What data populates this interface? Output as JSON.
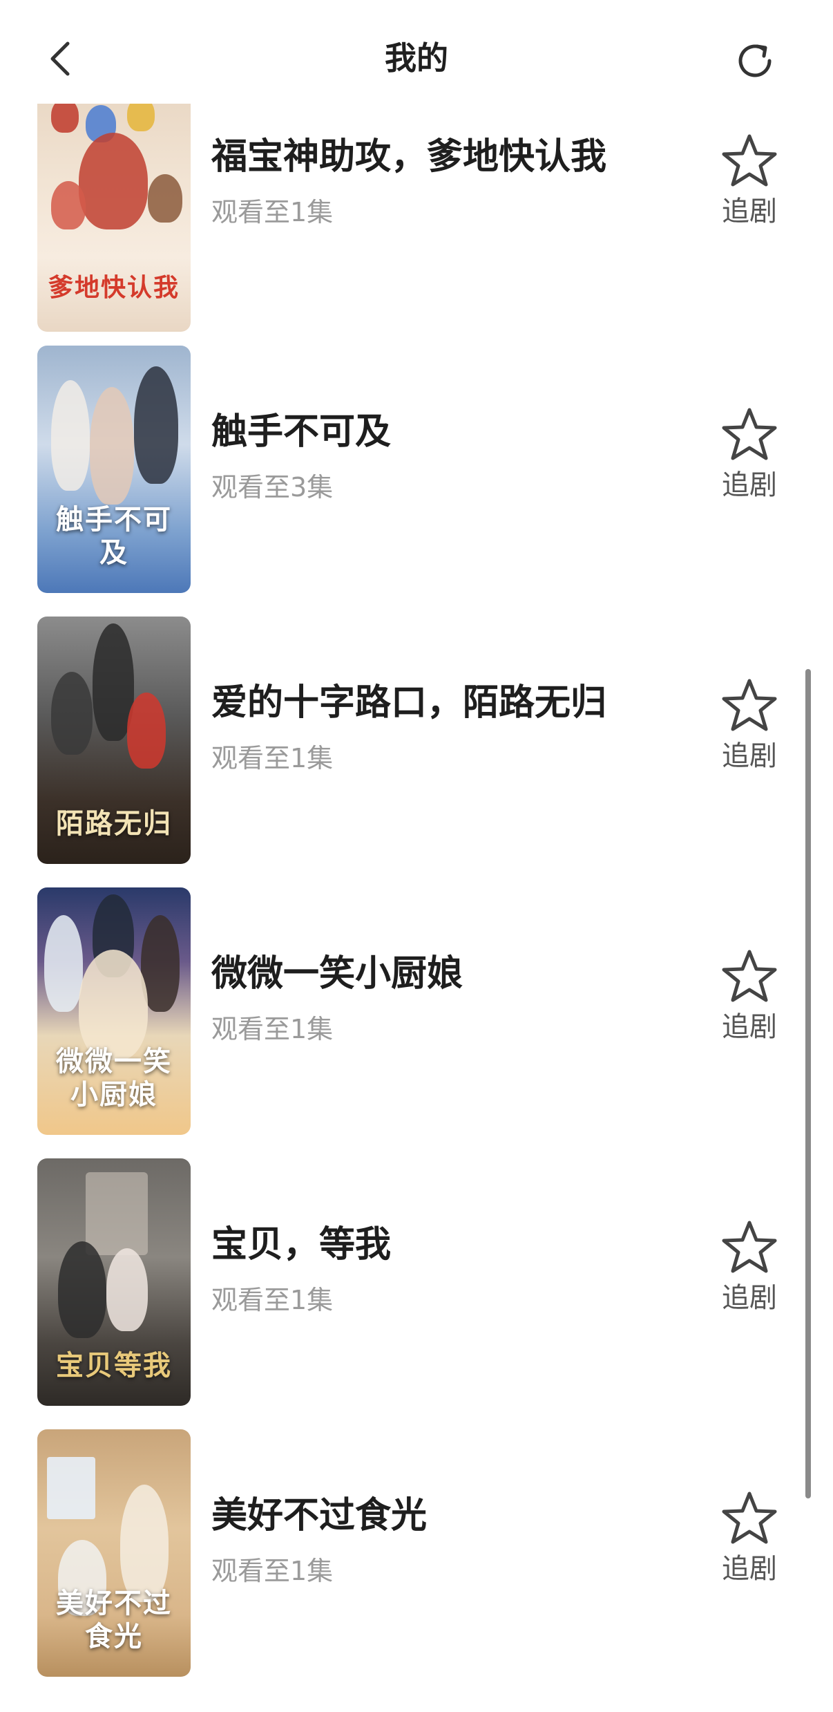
{
  "header": {
    "title": "我的",
    "back_icon": "chevron-left-icon",
    "refresh_icon": "refresh-icon"
  },
  "list": {
    "items": [
      {
        "title": "福宝神助攻，爹地快认我",
        "progress": "观看至1集",
        "follow_label": "追剧",
        "poster_text": "爹地快认我"
      },
      {
        "title": "触手不可及",
        "progress": "观看至3集",
        "follow_label": "追剧",
        "poster_text": "触手不可及"
      },
      {
        "title": "爱的十字路口，陌路无归",
        "progress": "观看至1集",
        "follow_label": "追剧",
        "poster_text": "陌路无归"
      },
      {
        "title": "微微一笑小厨娘",
        "progress": "观看至1集",
        "follow_label": "追剧",
        "poster_text": "微微一笑 小厨娘"
      },
      {
        "title": "宝贝，等我",
        "progress": "观看至1集",
        "follow_label": "追剧",
        "poster_text": "宝贝等我"
      },
      {
        "title": "美好不过食光",
        "progress": "观看至1集",
        "follow_label": "追剧",
        "poster_text": "美好不过 食光"
      }
    ]
  },
  "colors": {
    "title_text": "#1e1e1e",
    "secondary_text": "#9a9a9a",
    "icon": "#444444"
  }
}
